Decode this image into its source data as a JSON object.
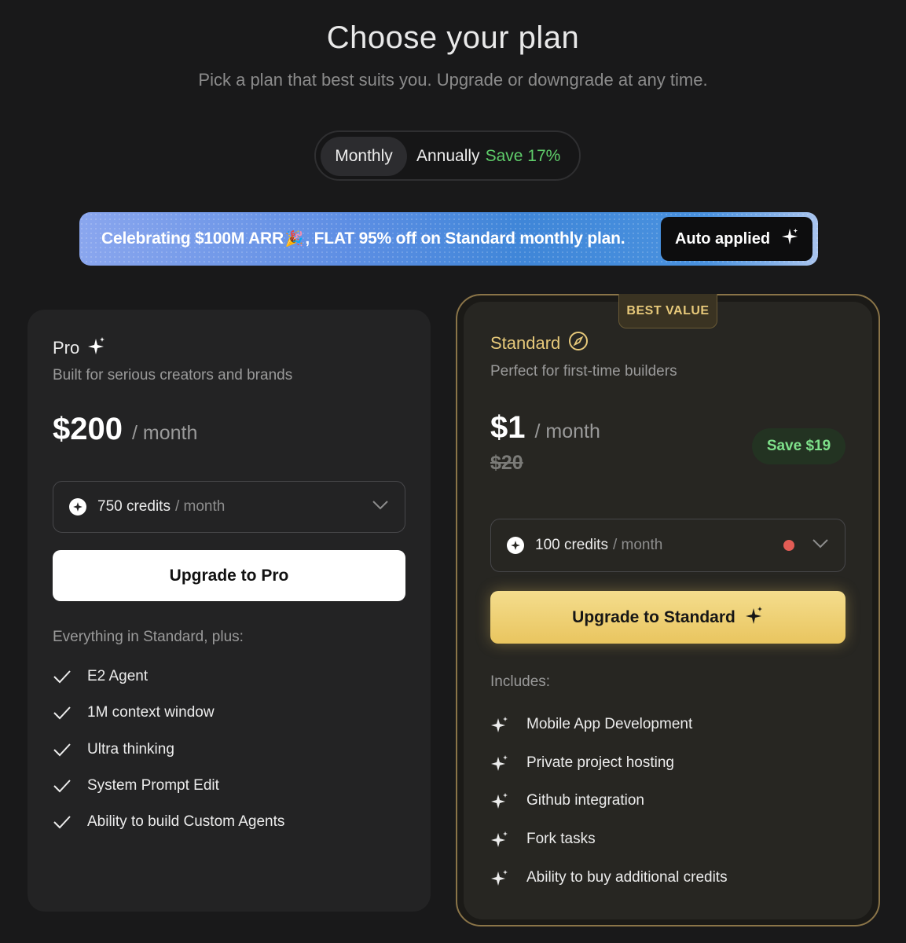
{
  "header": {
    "title": "Choose your plan",
    "subtitle": "Pick a plan that best suits you. Upgrade or downgrade at any time."
  },
  "billing_toggle": {
    "monthly_label": "Monthly",
    "annual_label": "Annually",
    "annual_save": "Save 17%",
    "selected": "Monthly"
  },
  "banner": {
    "text_before_emoji": "Celebrating $100M ARR",
    "emoji": "🎉",
    "text_after_emoji": ", FLAT 95% off on Standard monthly plan.",
    "button_label": "Auto applied"
  },
  "pro": {
    "name": "Pro",
    "description": "Built for serious creators and brands",
    "price": "$200",
    "period": "/ month",
    "credits": "750 credits",
    "credits_period": "/ month",
    "button_label": "Upgrade to Pro",
    "features_heading": "Everything in Standard, plus:",
    "features": [
      "E2 Agent",
      "1M context window",
      "Ultra thinking",
      "System Prompt Edit",
      "Ability to build Custom Agents"
    ]
  },
  "standard": {
    "badge": "BEST VALUE",
    "name": "Standard",
    "description": "Perfect for first-time builders",
    "price": "$1",
    "period": "/ month",
    "original_price": "$20",
    "save_label": "Save $19",
    "credits": "100 credits",
    "credits_period": "/ month",
    "button_label": "Upgrade to Standard",
    "features_heading": "Includes:",
    "features": [
      "Mobile App Development",
      "Private project hosting",
      "Github integration",
      "Fork tasks",
      "Ability to buy additional credits"
    ]
  },
  "colors": {
    "background": "#19191a",
    "accent_gold": "#e9c55f",
    "save_green": "#5fcd6a",
    "status_dot": "#e25c55"
  }
}
